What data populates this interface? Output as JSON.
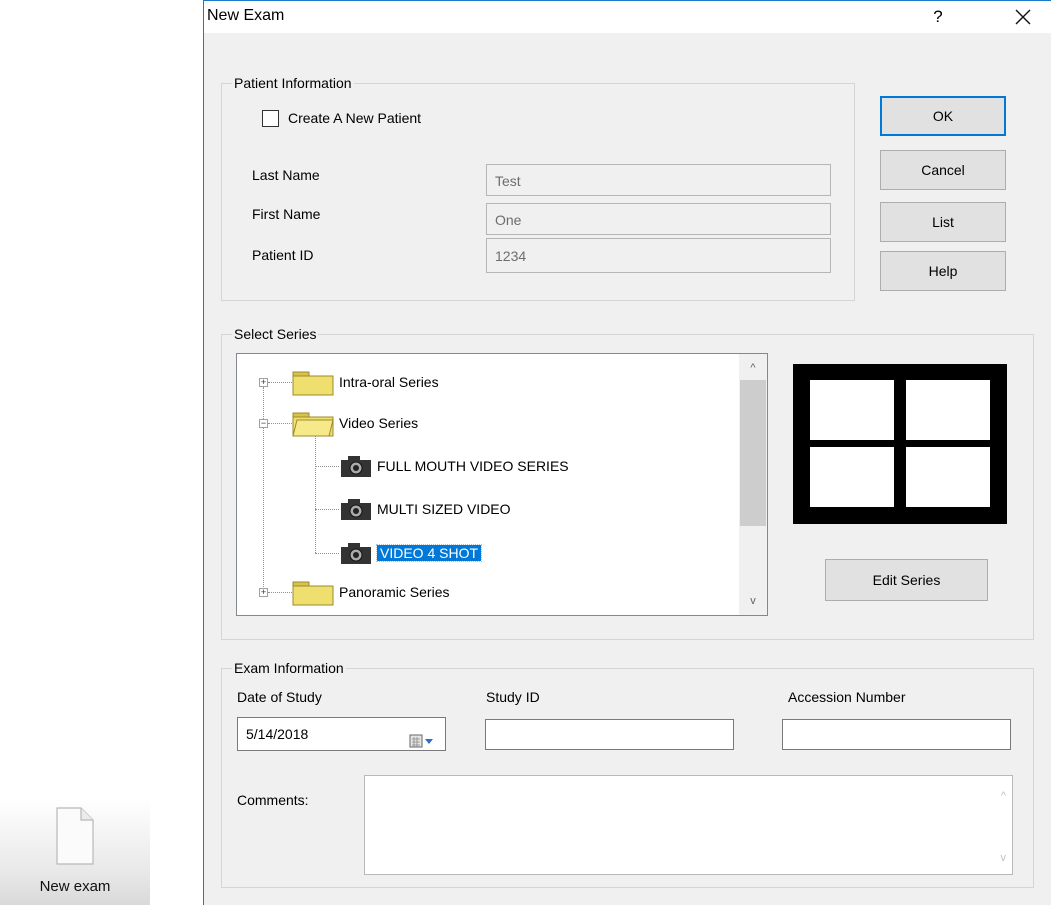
{
  "desktop": {
    "shortcut_label": "New exam"
  },
  "dialog": {
    "title": "New Exam",
    "help_symbol": "?",
    "close_symbol": "✕"
  },
  "patient_info": {
    "legend": "Patient Information",
    "create_new_label": "Create A New Patient",
    "create_new_checked": false,
    "last_name_label": "Last Name",
    "last_name_value": "Test",
    "first_name_label": "First Name",
    "first_name_value": "One",
    "patient_id_label": "Patient ID",
    "patient_id_value": "1234"
  },
  "buttons": {
    "ok": "OK",
    "cancel": "Cancel",
    "list": "List",
    "help": "Help",
    "edit_series": "Edit Series"
  },
  "series": {
    "legend": "Select Series",
    "tree": [
      {
        "label": "Intra-oral Series",
        "type": "folder",
        "expanded": false
      },
      {
        "label": "Video Series",
        "type": "folder",
        "expanded": true
      },
      {
        "label": "FULL MOUTH VIDEO SERIES",
        "type": "camera"
      },
      {
        "label": "MULTI SIZED VIDEO",
        "type": "camera"
      },
      {
        "label": "VIDEO 4 SHOT",
        "type": "camera",
        "selected": true
      },
      {
        "label": "Panoramic Series",
        "type": "folder",
        "expanded": false
      }
    ],
    "scroll_up": "^",
    "scroll_down": "v"
  },
  "exam_info": {
    "legend": "Exam Information",
    "date_label": "Date of Study",
    "date_value": "5/14/2018",
    "study_id_label": "Study ID",
    "study_id_value": "",
    "accession_label": "Accession Number",
    "accession_value": "",
    "comments_label": "Comments:",
    "comments_value": ""
  },
  "colors": {
    "selection": "#0078d7",
    "dialog_bg": "#f0f0f0",
    "folder": "#e9d65a"
  }
}
